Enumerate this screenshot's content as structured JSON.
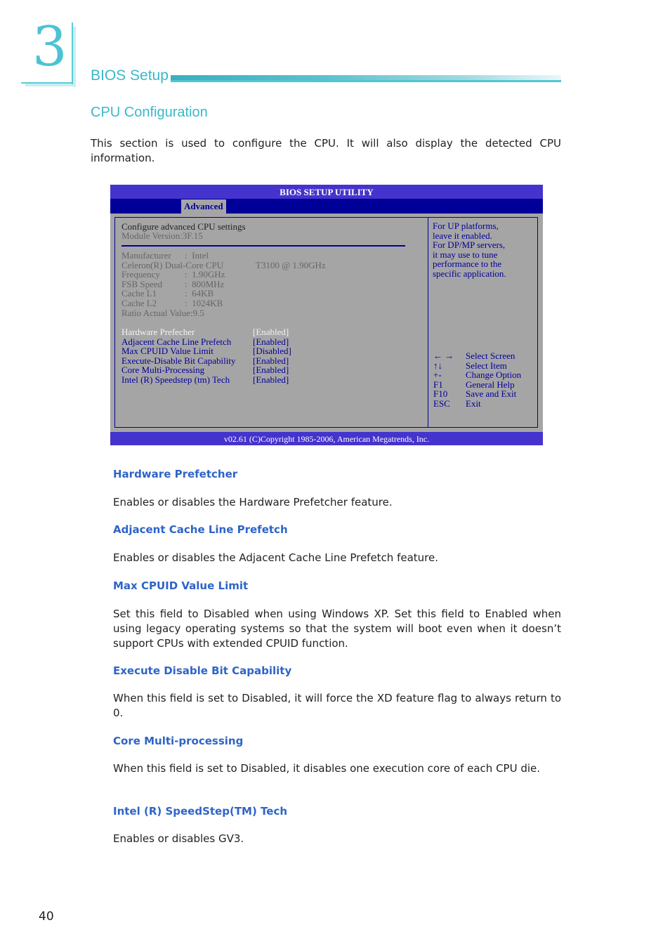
{
  "chapter": {
    "number": "3",
    "title": "BIOS Setup"
  },
  "section": {
    "title": "CPU Configuration",
    "intro": "This section is used to configure the CPU. It will also display the detected CPU information."
  },
  "bios": {
    "title": "BIOS SETUP UTILITY",
    "active_tab": "Advanced",
    "header_lines": [
      "Configure advanced CPU settings",
      "Module Version:3F.15"
    ],
    "info_lines": [
      {
        "label": "Manufacturer",
        "value": ":  Intel"
      },
      {
        "label": "Celeron(R) Dual-Core CPU",
        "value": "T3100 @ 1.90GHz"
      },
      {
        "label": "Frequency",
        "value": ":  1.90GHz"
      },
      {
        "label": "FSB Speed",
        "value": ":  800MHz"
      },
      {
        "label": "Cache L1",
        "value": ":  64KB"
      },
      {
        "label": "Cache L2",
        "value": ":  1024KB"
      },
      {
        "label": "Ratio Actual Value:9.5",
        "value": ""
      }
    ],
    "settings": [
      {
        "label": "Hardware Prefecher",
        "value": "[Enabled]",
        "selected": true
      },
      {
        "label": "Adjacent Cache Line Prefetch",
        "value": "[Enabled]",
        "selected": false
      },
      {
        "label": "Max CPUID Value Limit",
        "value": "[Disabled]",
        "selected": false
      },
      {
        "label": "Execute-Disable Bit Capability",
        "value": "[Enabled]",
        "selected": false
      },
      {
        "label": "Core Multi-Processing",
        "value": "[Enabled]",
        "selected": false
      },
      {
        "label": "Intel (R) Speedstep (tm) Tech",
        "value": "[Enabled]",
        "selected": false
      }
    ],
    "help_lines": [
      "For UP platforms,",
      "leave it enabled.",
      "For DP/MP servers,",
      "it may use to tune",
      "performance to the",
      "specific application."
    ],
    "keys": [
      {
        "key": "← →",
        "desc": "Select Screen"
      },
      {
        "key": "↑↓",
        "desc": "Select Item"
      },
      {
        "key": "+-",
        "desc": "Change Option"
      },
      {
        "key": "F1",
        "desc": "General Help"
      },
      {
        "key": "F10",
        "desc": "Save and Exit"
      },
      {
        "key": "ESC",
        "desc": "Exit"
      }
    ],
    "footer": "v02.61 (C)Copyright 1985-2006, American Megatrends, Inc.",
    "colors": {
      "title_bar": "#4433cc",
      "tab_bar": "#000099",
      "panel": "#a6a5a6",
      "text_blue": "#000099"
    }
  },
  "descriptions": [
    {
      "heading": "Hardware Prefetcher",
      "body": "Enables or disables the Hardware Prefetcher feature."
    },
    {
      "heading": "Adjacent Cache Line Prefetch",
      "body": "Enables or disables the Adjacent Cache Line Prefetch feature."
    },
    {
      "heading": "Max CPUID Value Limit",
      "body": "Set this field to Disabled when using Windows XP. Set this field to Enabled when using legacy operating systems so that the system will boot even when it doesn’t support CPUs with extended CPUID function."
    },
    {
      "heading": "Execute Disable Bit Capability",
      "body": "When this field is set to Disabled, it will force the XD feature flag to always return to 0."
    },
    {
      "heading": "Core Multi-processing",
      "body": "When this field is set to Disabled, it disables one execution core of each CPU die."
    },
    {
      "heading": "Intel (R) SpeedStep(TM) Tech",
      "body": "Enables or disables GV3."
    }
  ],
  "page_number": "40",
  "colors": {
    "chapter_accent": "#3ab8c8",
    "heading_blue": "#2e64c8"
  }
}
